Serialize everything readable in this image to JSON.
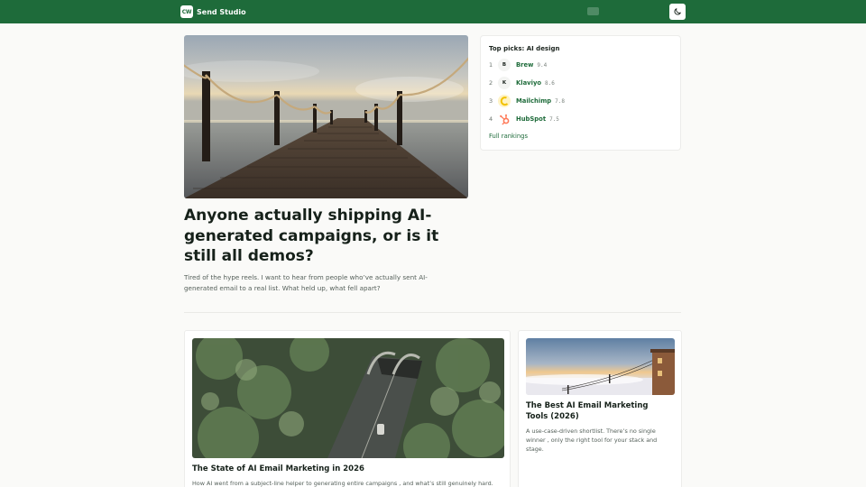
{
  "header": {
    "logo_text": "CW",
    "site_name": "Send Studio",
    "theme_toggle_icon": "moon-icon",
    "colors": {
      "brand": "#1e6b3a"
    }
  },
  "hero": {
    "title": "Anyone actually shipping AI-generated campaigns, or is it still all demos?",
    "description": "Tired of the hype reels. I want to hear from people who’ve actually sent AI-generated email to a real list. What held up, what fell apart?"
  },
  "top_picks": {
    "title": "Top picks: AI design",
    "items": [
      {
        "rank": "1",
        "name": "Brew",
        "score": "9.4",
        "logo": "B"
      },
      {
        "rank": "2",
        "name": "Klaviyo",
        "score": "8.6",
        "logo": "K"
      },
      {
        "rank": "3",
        "name": "Mailchimp",
        "score": "7.8",
        "logo": ""
      },
      {
        "rank": "4",
        "name": "HubSpot",
        "score": "7.5",
        "logo": ""
      }
    ],
    "link": "Full rankings"
  },
  "articles": [
    {
      "title": "The State of AI Email Marketing in 2026",
      "description": "How AI went from a subject-line helper to generating entire campaigns , and what’s still genuinely hard."
    },
    {
      "title": "The Best AI Email Marketing Tools (2026)",
      "description": "A use-case-driven shortlist. There’s no single winner , only the right tool for your stack and stage."
    }
  ]
}
